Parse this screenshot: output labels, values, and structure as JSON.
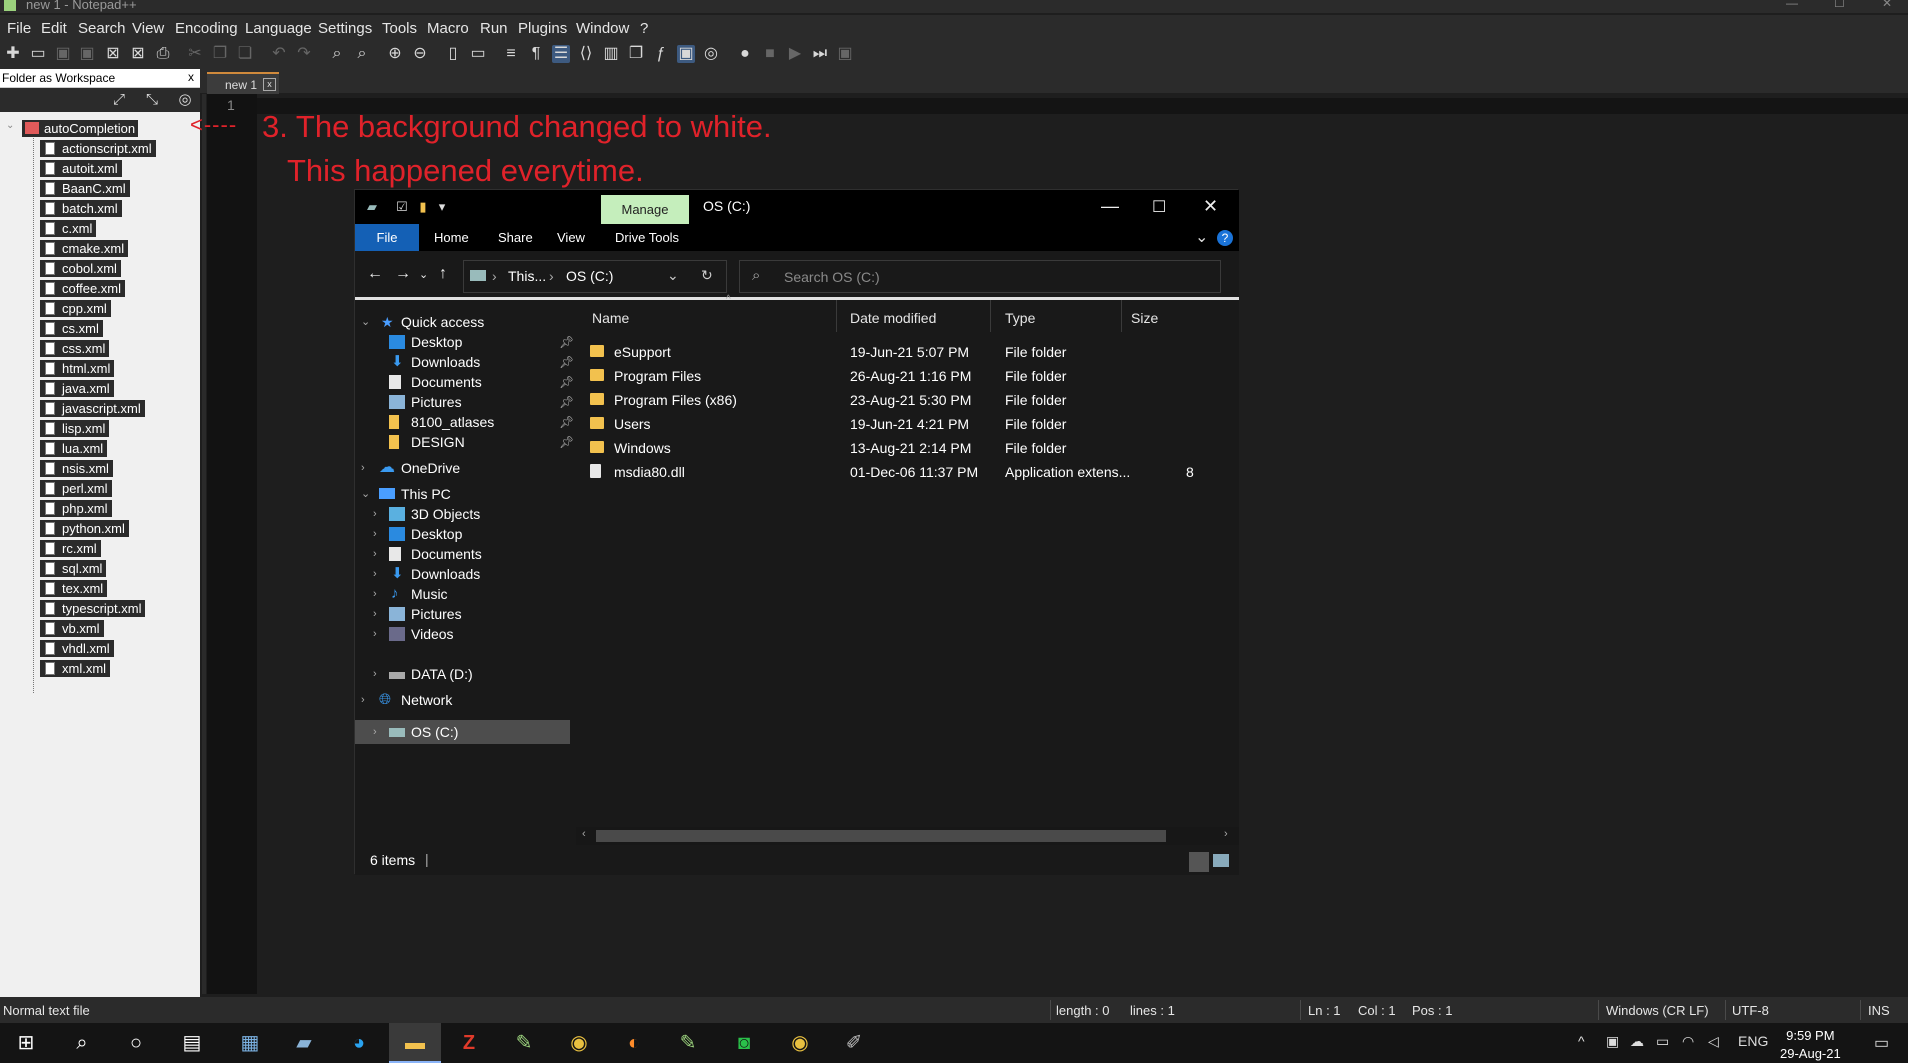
{
  "window": {
    "title": "new 1 - Notepad++",
    "controls": [
      "—",
      "☐",
      "✕"
    ]
  },
  "menu": [
    "File",
    "Edit",
    "Search",
    "View",
    "Encoding",
    "Language",
    "Settings",
    "Tools",
    "Macro",
    "Run",
    "Plugins",
    "Window",
    "?"
  ],
  "workspace": {
    "title": "Folder as Workspace",
    "close": "x",
    "root": "autoCompletion",
    "files": [
      "actionscript.xml",
      "autoit.xml",
      "BaanC.xml",
      "batch.xml",
      "c.xml",
      "cmake.xml",
      "cobol.xml",
      "coffee.xml",
      "cpp.xml",
      "cs.xml",
      "css.xml",
      "html.xml",
      "java.xml",
      "javascript.xml",
      "lisp.xml",
      "lua.xml",
      "nsis.xml",
      "perl.xml",
      "php.xml",
      "python.xml",
      "rc.xml",
      "sql.xml",
      "tex.xml",
      "typescript.xml",
      "vb.xml",
      "vhdl.xml",
      "xml.xml"
    ]
  },
  "editor": {
    "tab_label": "new 1",
    "tab_close": "x",
    "line_number": "1"
  },
  "annotation": {
    "arrow": "<----",
    "line1": "3. The background changed to white.",
    "line2": "This happened everytime."
  },
  "explorer": {
    "title": "OS (C:)",
    "manage": "Manage",
    "ribbon_tabs": [
      "File",
      "Home",
      "Share",
      "View",
      "Drive Tools"
    ],
    "address": {
      "part1": "This...",
      "part2": "OS (C:)"
    },
    "search_placeholder": "Search OS (C:)",
    "nav": {
      "quick_access": "Quick access",
      "quick_items": [
        "Desktop",
        "Downloads",
        "Documents",
        "Pictures",
        "8100_atlases",
        "DESIGN"
      ],
      "onedrive": "OneDrive",
      "this_pc": "This PC",
      "pc_items": [
        "3D Objects",
        "Desktop",
        "Documents",
        "Downloads",
        "Music",
        "Pictures",
        "Videos",
        "OS (C:)",
        "DATA (D:)"
      ],
      "network": "Network"
    },
    "columns": [
      "Name",
      "Date modified",
      "Type",
      "Size"
    ],
    "rows": [
      {
        "name": "eSupport",
        "date": "19-Jun-21 5:07 PM",
        "type": "File folder",
        "size": ""
      },
      {
        "name": "Program Files",
        "date": "26-Aug-21 1:16 PM",
        "type": "File folder",
        "size": ""
      },
      {
        "name": "Program Files (x86)",
        "date": "23-Aug-21 5:30 PM",
        "type": "File folder",
        "size": ""
      },
      {
        "name": "Users",
        "date": "19-Jun-21 4:21 PM",
        "type": "File folder",
        "size": ""
      },
      {
        "name": "Windows",
        "date": "13-Aug-21 2:14 PM",
        "type": "File folder",
        "size": ""
      },
      {
        "name": "msdia80.dll",
        "date": "01-Dec-06 11:37 PM",
        "type": "Application extens...",
        "size": "8"
      }
    ],
    "status": "6 items"
  },
  "statusbar": {
    "filetype": "Normal text file",
    "length": "length : 0",
    "lines": "lines : 1",
    "ln": "Ln : 1",
    "col": "Col : 1",
    "pos": "Pos : 1",
    "eol": "Windows (CR LF)",
    "encoding": "UTF-8",
    "mode": "INS"
  },
  "taskbar": {
    "lang": "ENG",
    "time": "9:59 PM",
    "date": "29-Aug-21"
  }
}
